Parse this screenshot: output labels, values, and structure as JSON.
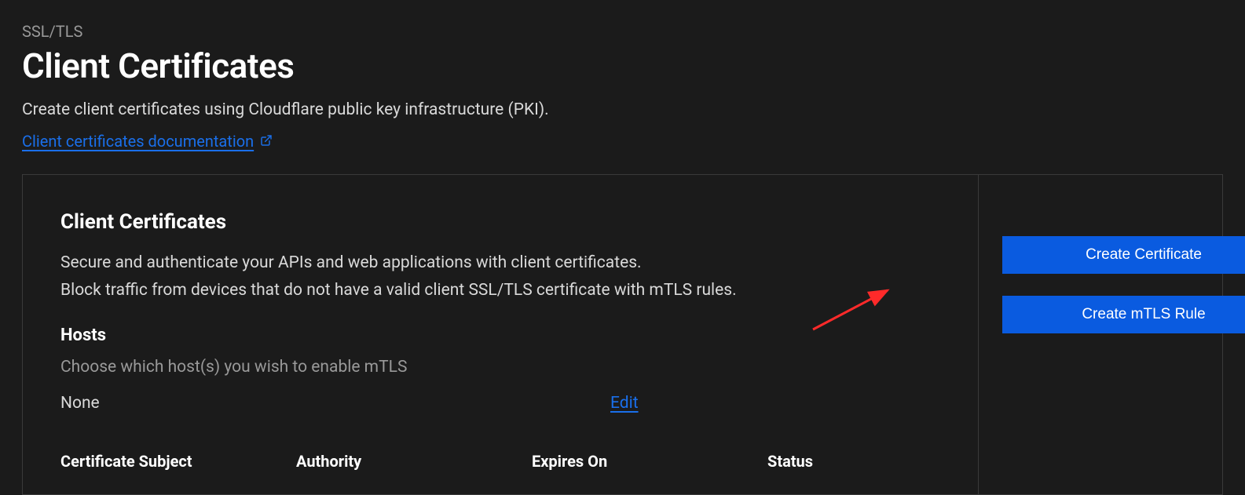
{
  "breadcrumb": "SSL/TLS",
  "page_title": "Client Certificates",
  "page_description": "Create client certificates using Cloudflare public key infrastructure (PKI).",
  "doc_link_text": "Client certificates documentation",
  "card": {
    "title": "Client Certificates",
    "description_line1": "Secure and authenticate your APIs and web applications with client certificates.",
    "description_line2": "Block traffic from devices that do not have a valid client SSL/TLS certificate with mTLS rules.",
    "hosts": {
      "title": "Hosts",
      "description": "Choose which host(s) you wish to enable mTLS",
      "value": "None",
      "edit_label": "Edit"
    },
    "buttons": {
      "create_certificate": "Create Certificate",
      "create_mtls_rule": "Create mTLS Rule"
    }
  },
  "table": {
    "headers": {
      "subject": "Certificate Subject",
      "authority": "Authority",
      "expires": "Expires On",
      "status": "Status"
    }
  }
}
